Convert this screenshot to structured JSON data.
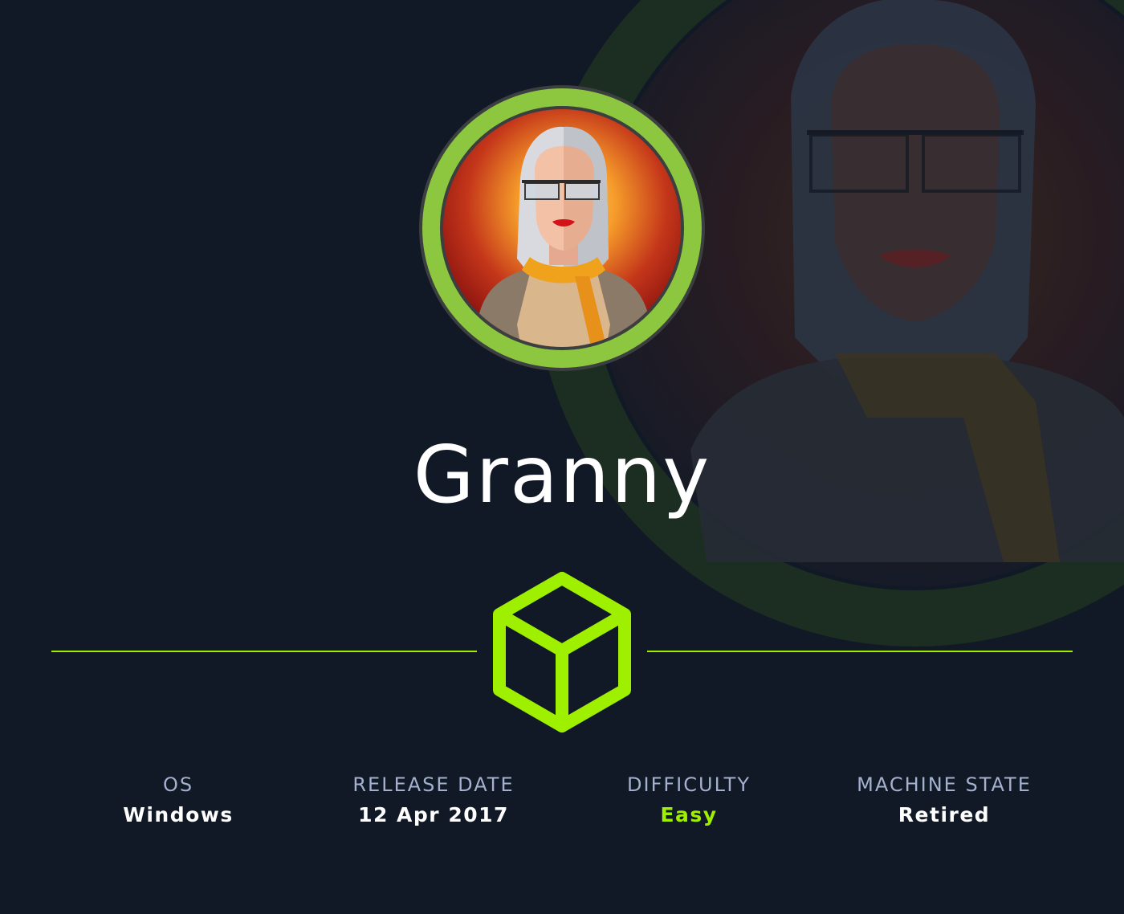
{
  "machine": {
    "name": "Granny"
  },
  "stats": {
    "os": {
      "label": "OS",
      "value": "Windows"
    },
    "release_date": {
      "label": "RELEASE DATE",
      "value": "12 Apr 2017"
    },
    "difficulty": {
      "label": "DIFFICULTY",
      "value": "Easy"
    },
    "machine_state": {
      "label": "MACHINE STATE",
      "value": "Retired"
    }
  },
  "icons": {
    "avatar": "granny-avatar",
    "difficulty_badge": "cube-icon"
  },
  "colors": {
    "background": "#111927",
    "accent": "#9fef00",
    "ring": "#8dc63f",
    "label": "#a4b1cd",
    "text": "#ffffff"
  }
}
